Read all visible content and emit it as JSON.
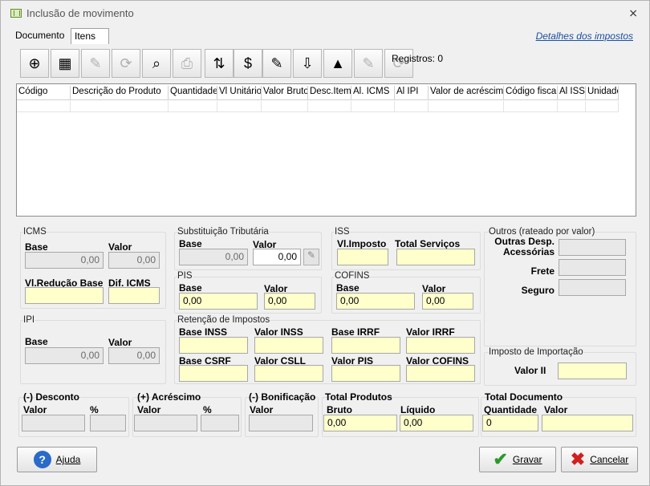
{
  "window": {
    "title": "Inclusão de movimento",
    "close_glyph": "⨯"
  },
  "tabs": [
    "Documento",
    "Itens"
  ],
  "link": "Detalhes dos impostos",
  "records": "Registros: 0",
  "toolbar": [
    {
      "icon": "new-document-icon",
      "glyph": "⊕"
    },
    {
      "icon": "spreadsheet-icon",
      "glyph": "▦"
    },
    {
      "icon": "edit-icon",
      "glyph": "✎"
    },
    {
      "icon": "refresh-icon",
      "glyph": "⟳"
    },
    {
      "icon": "magnifier-icon",
      "glyph": "⌕"
    },
    {
      "icon": "printer-icon",
      "glyph": "⎙"
    },
    {
      "icon": "sort-icon",
      "glyph": "⇅"
    },
    {
      "icon": "money-icon",
      "glyph": "$"
    },
    {
      "icon": "note-icon",
      "glyph": "✎"
    },
    {
      "icon": "import-icon",
      "glyph": "⇩"
    },
    {
      "icon": "image-icon",
      "glyph": "▲"
    },
    {
      "icon": "edit-disabled-icon",
      "glyph": "✎"
    },
    {
      "icon": "refresh-disabled-icon",
      "glyph": "⟳"
    }
  ],
  "grid": {
    "columns": [
      "Código",
      "Descrição do Produto",
      "Quantidade",
      "Vl Unitário",
      "Valor Bruto",
      "Desc.Item",
      "Al. ICMS",
      "Al IPI",
      "Valor de acréscimo",
      "Código fiscal",
      "Al ISS",
      "Unidade"
    ]
  },
  "icms": {
    "title": "ICMS",
    "base_label": "Base",
    "valor_label": "Valor",
    "base": "0,00",
    "valor": "0,00",
    "reducao_label": "Vl.Redução Base",
    "dif_label": "Dif. ICMS"
  },
  "st": {
    "title": "Substituição Tributária",
    "base_label": "Base",
    "valor_label": "Valor",
    "base": "0,00",
    "valor": "0,00"
  },
  "iss": {
    "title": "ISS",
    "imposto_label": "Vl.Imposto",
    "servicos_label": "Total Serviços"
  },
  "outros": {
    "title": "Outros (rateado por valor)",
    "desp_label": "Outras Desp. Acessórias",
    "frete_label": "Frete",
    "seguro_label": "Seguro"
  },
  "pis": {
    "title": "PIS",
    "base_label": "Base",
    "valor_label": "Valor",
    "base": "0,00",
    "valor": "0,00"
  },
  "cofins": {
    "title": "COFINS",
    "base_label": "Base",
    "valor_label": "Valor",
    "base": "0,00",
    "valor": "0,00"
  },
  "ipi": {
    "title": "IPI",
    "base_label": "Base",
    "valor_label": "Valor",
    "base": "0,00",
    "valor": "0,00"
  },
  "retencao": {
    "title": "Retenção de Impostos",
    "base_inss": "Base INSS",
    "valor_inss": "Valor INSS",
    "base_irrf": "Base IRRF",
    "valor_irrf": "Valor IRRF",
    "base_csrf": "Base CSRF",
    "valor_csll": "Valor CSLL",
    "valor_pis": "Valor PIS",
    "valor_cofins": "Valor COFINS"
  },
  "importacao": {
    "title": "Imposto de Importação",
    "valor_ii_label": "Valor II"
  },
  "desconto": {
    "title": "(-) Desconto",
    "valor_label": "Valor",
    "pct_label": "%"
  },
  "acrescimo": {
    "title": "(+) Acréscimo",
    "valor_label": "Valor",
    "pct_label": "%"
  },
  "bonificacao": {
    "title": "(-) Bonificação",
    "valor_label": "Valor"
  },
  "produtos": {
    "title": "Total Produtos",
    "bruto_label": "Bruto",
    "liquido_label": "Líquido",
    "bruto": "0,00",
    "liquido": "0,00"
  },
  "documento": {
    "title": "Total Documento",
    "qtd_label": "Quantidade",
    "valor_label": "Valor",
    "qtd": "0"
  },
  "buttons": {
    "ajuda": "Ajuda",
    "gravar": "Gravar",
    "cancelar": "Cancelar"
  }
}
